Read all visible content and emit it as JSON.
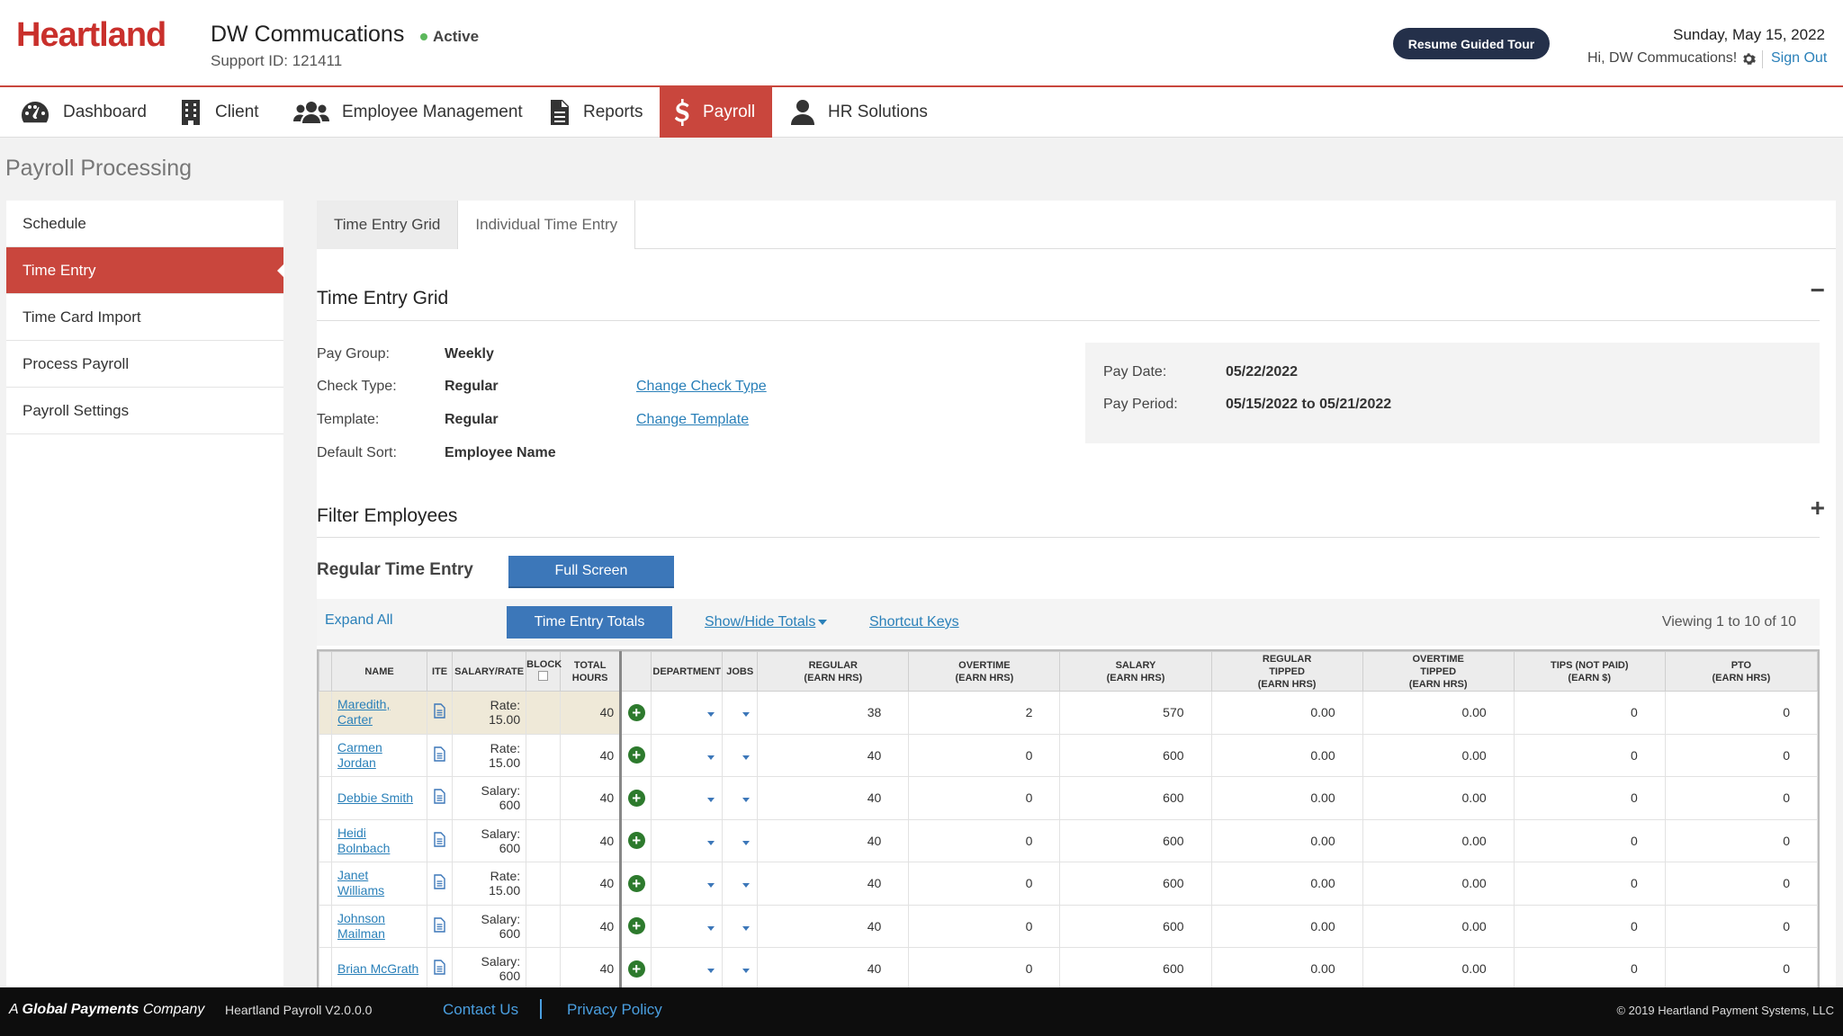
{
  "header": {
    "logo": "Heartland",
    "client_name": "DW Commucations",
    "status": "Active",
    "support_id": "Support ID: 121411",
    "tour_button": "Resume Guided Tour",
    "date": "Sunday, May 15, 2022",
    "greeting": "Hi, DW Commucations!",
    "sign_out": "Sign Out"
  },
  "nav": {
    "items": [
      {
        "label": "Dashboard",
        "icon": "dashboard-icon"
      },
      {
        "label": "Client",
        "icon": "building-icon"
      },
      {
        "label": "Employee Management",
        "icon": "users-icon"
      },
      {
        "label": "Reports",
        "icon": "document-icon"
      },
      {
        "label": "Payroll",
        "icon": "dollar-icon",
        "active": true
      },
      {
        "label": "HR Solutions",
        "icon": "user-icon"
      }
    ]
  },
  "page": {
    "title": "Payroll Processing"
  },
  "sidebar": {
    "items": [
      {
        "label": "Schedule"
      },
      {
        "label": "Time Entry",
        "active": true
      },
      {
        "label": "Time Card Import"
      },
      {
        "label": "Process Payroll"
      },
      {
        "label": "Payroll Settings"
      }
    ]
  },
  "tabs": [
    "Time Entry Grid",
    "Individual Time Entry"
  ],
  "time_entry_grid": {
    "title": "Time Entry Grid",
    "toggle": "−",
    "fields": [
      {
        "label": "Pay Group:",
        "value": "Weekly",
        "link": ""
      },
      {
        "label": "Check Type:",
        "value": "Regular",
        "link": "Change Check Type"
      },
      {
        "label": "Template:",
        "value": "Regular",
        "link": "Change Template"
      },
      {
        "label": "Default Sort:",
        "value": "Employee Name",
        "link": ""
      }
    ],
    "pay_date_label": "Pay Date:",
    "pay_date": "05/22/2022",
    "pay_period_label": "Pay Period:",
    "pay_period": "05/15/2022 to 05/21/2022"
  },
  "filter": {
    "title": "Filter Employees",
    "toggle": "+"
  },
  "regular": {
    "title": "Regular Time Entry",
    "full_screen": "Full Screen",
    "expand_all": "Expand All",
    "totals_button": "Time Entry Totals",
    "show_hide": "Show/Hide Totals",
    "shortcut": "Shortcut Keys",
    "viewing": "Viewing 1 to 10 of 10"
  },
  "grid": {
    "columns": {
      "name": "NAME",
      "ite": "ITE",
      "salary_rate": "SALARY/RATE",
      "block": "BLOCK",
      "total_hours_1": "TOTAL",
      "total_hours_2": "HOURS",
      "department": "DEPARTMENT",
      "jobs": "JOBS",
      "regular_1": "REGULAR",
      "regular_2": "(EARN HRS)",
      "overtime_1": "OVERTIME",
      "overtime_2": "(EARN HRS)",
      "salary_1": "SALARY",
      "salary_2": "(EARN HRS)",
      "regtip_1": "REGULAR",
      "regtip_2": "TIPPED",
      "regtip_3": "(EARN HRS)",
      "ottip_1": "OVERTIME",
      "ottip_2": "TIPPED",
      "ottip_3": "(EARN HRS)",
      "tips_1": "TIPS (NOT PAID)",
      "tips_2": "(EARN $)",
      "pto_1": "PTO",
      "pto_2": "(EARN HRS)"
    },
    "rows": [
      {
        "name1": "Maredith,",
        "name2": "Carter",
        "rate1": "Rate:",
        "rate2": "15.00",
        "total": "40",
        "regular": "38",
        "overtime": "2",
        "salary": "570",
        "regtip": "0.00",
        "ottip": "0.00",
        "tips": "0",
        "pto": "0"
      },
      {
        "name1": "Carmen",
        "name2": "Jordan",
        "rate1": "Rate:",
        "rate2": "15.00",
        "total": "40",
        "regular": "40",
        "overtime": "0",
        "salary": "600",
        "regtip": "0.00",
        "ottip": "0.00",
        "tips": "0",
        "pto": "0"
      },
      {
        "name1": "Debbie Smith",
        "name2": "",
        "rate1": "Salary:",
        "rate2": "600",
        "total": "40",
        "regular": "40",
        "overtime": "0",
        "salary": "600",
        "regtip": "0.00",
        "ottip": "0.00",
        "tips": "0",
        "pto": "0"
      },
      {
        "name1": "Heidi",
        "name2": "Bolnbach",
        "rate1": "Salary:",
        "rate2": "600",
        "total": "40",
        "regular": "40",
        "overtime": "0",
        "salary": "600",
        "regtip": "0.00",
        "ottip": "0.00",
        "tips": "0",
        "pto": "0"
      },
      {
        "name1": "Janet",
        "name2": "Williams",
        "rate1": "Rate:",
        "rate2": "15.00",
        "total": "40",
        "regular": "40",
        "overtime": "0",
        "salary": "600",
        "regtip": "0.00",
        "ottip": "0.00",
        "tips": "0",
        "pto": "0"
      },
      {
        "name1": "Johnson",
        "name2": "Mailman",
        "rate1": "Salary:",
        "rate2": "600",
        "total": "40",
        "regular": "40",
        "overtime": "0",
        "salary": "600",
        "regtip": "0.00",
        "ottip": "0.00",
        "tips": "0",
        "pto": "0"
      },
      {
        "name1": "Brian McGrath",
        "name2": "",
        "rate1": "Salary:",
        "rate2": "600",
        "total": "40",
        "regular": "40",
        "overtime": "0",
        "salary": "600",
        "regtip": "0.00",
        "ottip": "0.00",
        "tips": "0",
        "pto": "0"
      }
    ]
  },
  "footer": {
    "brand_a": "A",
    "brand_b": "Global Payments",
    "brand_c": "Company",
    "version": "Heartland Payroll V2.0.0.0",
    "contact": "Contact Us",
    "privacy": "Privacy Policy",
    "copyright": "© 2019 Heartland Payment Systems, LLC"
  },
  "colors": {
    "brand_red": "#c9463d",
    "nav_active": "#c9463d",
    "primary_button": "#3c77b9",
    "link": "#2a80b9",
    "tour_button": "#24304a",
    "footer_bg": "#0d0d0d",
    "active_dot": "#5cb85c"
  }
}
